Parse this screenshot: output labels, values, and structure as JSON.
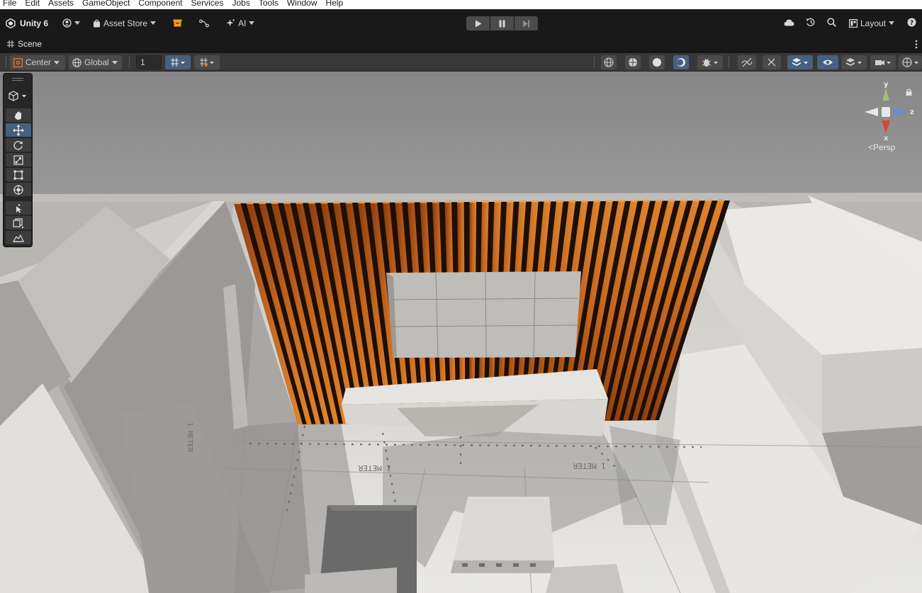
{
  "menubar": {
    "items": [
      "File",
      "Edit",
      "Assets",
      "GameObject",
      "Component",
      "Services",
      "Jobs",
      "Tools",
      "Window",
      "Help"
    ]
  },
  "toolbar": {
    "app_title": "Unity 6",
    "asset_store_label": "Asset Store",
    "ai_label": "AI",
    "layout_label": "Layout"
  },
  "scene_tab": {
    "label": "Scene"
  },
  "scene_toolbar": {
    "pivot_mode": "Center",
    "pivot_rotation": "Global",
    "grid_increment": "1"
  },
  "viewport": {
    "projection_label": "Persp",
    "gizmo_axes": {
      "y": "y",
      "z": "z",
      "x": "x"
    },
    "floor_labels": [
      "1 METER",
      "1 METER",
      "1 METER"
    ],
    "slat_color": "#c4661f",
    "ambient_color": "#8e8e8e"
  },
  "colors": {
    "accent": "#46607f",
    "play_icon": "#d6d6d6",
    "asset_store_badge": "#f39c1a"
  },
  "icons": {
    "logo": "unity-logo-icon",
    "account": "account-icon",
    "cloud": "cloud-icon",
    "history": "history-icon",
    "search": "search-icon",
    "help": "help-icon"
  }
}
